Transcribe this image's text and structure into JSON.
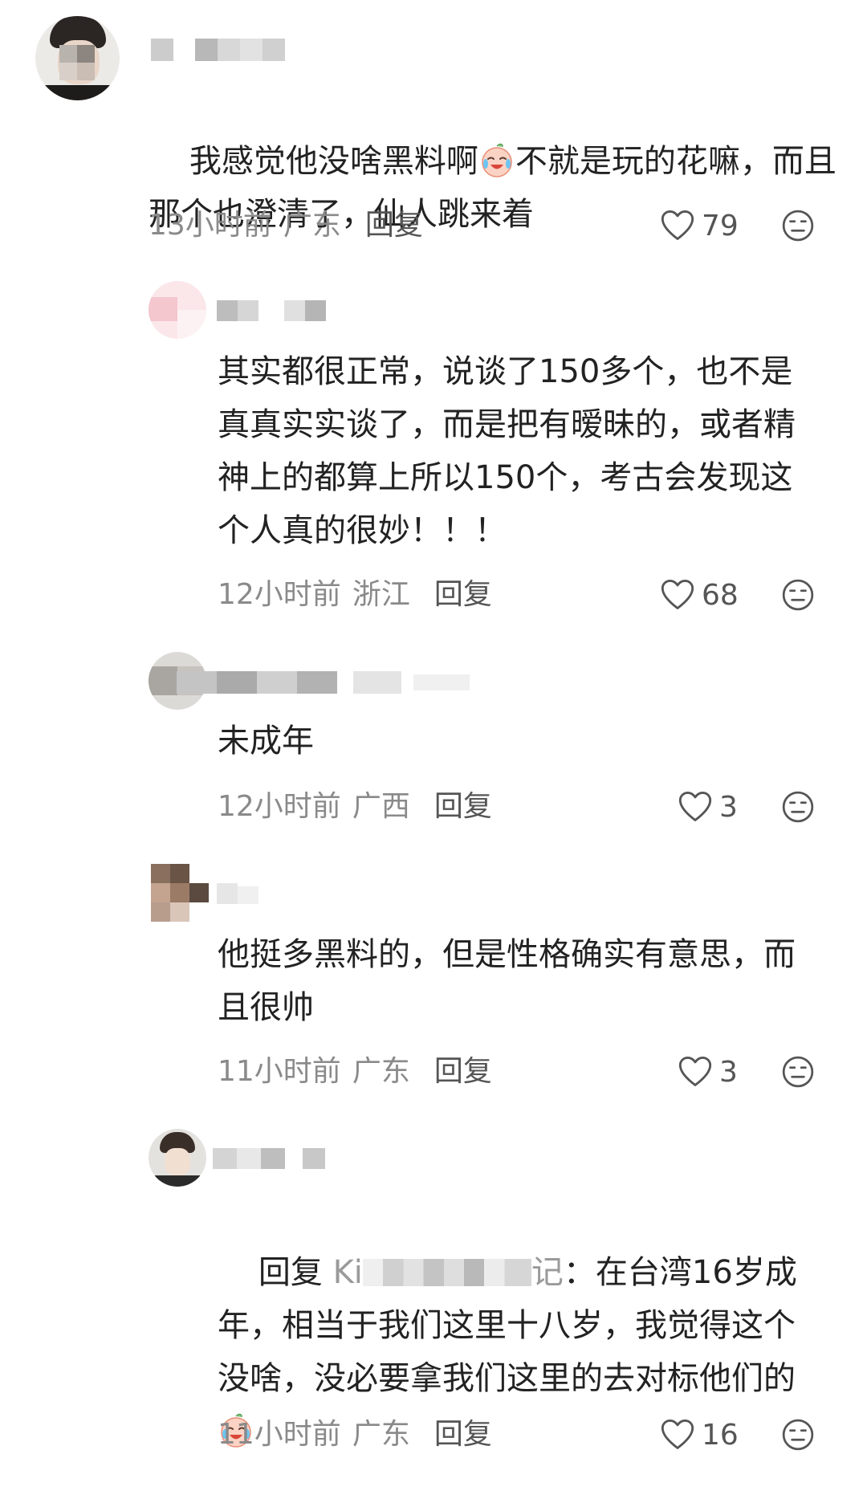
{
  "comments": [
    {
      "text_part1": "我感觉他没啥黑料啊",
      "text_part2": "不就是玩的花嘛，而且",
      "text_line2": "那个也澄清了，仙人跳来着",
      "time": "13小时前",
      "location": "广东",
      "reply_label": "回复",
      "likes": "79"
    },
    {
      "text": "其实都很正常，说谈了150多个，也不是\n真真实实谈了，而是把有暧昧的，或者精\n神上的都算上所以150个，考古会发现这\n个人真的很妙！！！",
      "time": "12小时前",
      "location": "浙江",
      "reply_label": "回复",
      "likes": "68"
    },
    {
      "text": "未成年",
      "time": "12小时前",
      "location": "广西",
      "reply_label": "回复",
      "likes": "3"
    },
    {
      "text": "他挺多黑料的，但是性格确实有意思，而\n且很帅",
      "time": "11小时前",
      "location": "广东",
      "reply_label": "回复",
      "likes": "3"
    },
    {
      "reply_prefix": "回复",
      "reply_target_initial": "Ki",
      "reply_target_tail": "记",
      "text_line1": "：在台湾16岁成",
      "text_rest": "年，相当于我们这里十八岁，我觉得这个\n没啥，没必要拿我们这里的去对标他们的",
      "time": "11小时前",
      "location": "广东",
      "reply_label": "回复",
      "likes": "16"
    }
  ],
  "icons": {
    "heart": "heart-outline-icon",
    "dislike": "neutral-face-icon",
    "emoji": "crying-laugh-emoji"
  },
  "colors": {
    "text": "#222222",
    "meta": "#8a8a8a",
    "icon": "#555555"
  }
}
